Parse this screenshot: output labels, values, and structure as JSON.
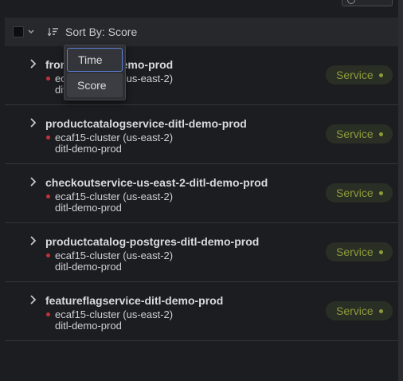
{
  "toolbar": {
    "sort_label": "Sort By: Score"
  },
  "sort_menu": {
    "options": [
      "Time",
      "Score"
    ]
  },
  "colors": {
    "status_dot": "#c0323a",
    "badge_text": "#8e9b3a",
    "focus_ring": "#5b7fd6"
  },
  "rows": [
    {
      "title": "frontend-ditl-demo-prod",
      "cluster": "ecaf15-cluster (us-east-2)",
      "env": "ditl-demo-prod",
      "badge": "Service"
    },
    {
      "title": "productcatalogservice-ditl-demo-prod",
      "cluster": "ecaf15-cluster (us-east-2)",
      "env": "ditl-demo-prod",
      "badge": "Service"
    },
    {
      "title": "checkoutservice-us-east-2-ditl-demo-prod",
      "cluster": "ecaf15-cluster (us-east-2)",
      "env": "ditl-demo-prod",
      "badge": "Service"
    },
    {
      "title": "productcatalog-postgres-ditl-demo-prod",
      "cluster": "ecaf15-cluster (us-east-2)",
      "env": "ditl-demo-prod",
      "badge": "Service"
    },
    {
      "title": "featureflagservice-ditl-demo-prod",
      "cluster": "ecaf15-cluster (us-east-2)",
      "env": "ditl-demo-prod",
      "badge": "Service"
    }
  ]
}
